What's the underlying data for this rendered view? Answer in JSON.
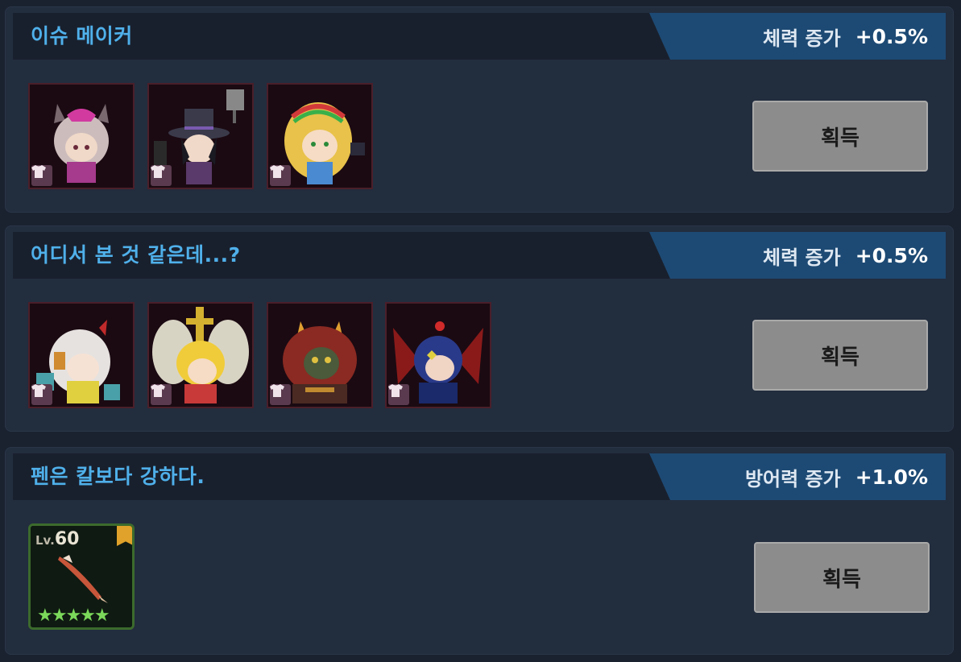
{
  "achievements": [
    {
      "title": "이슈 메이커",
      "bonus_stat": "체력 증가",
      "bonus_value": "+0.5%",
      "button_label": "획득",
      "rewards": [
        "costume-character-1",
        "costume-character-2",
        "costume-character-3"
      ]
    },
    {
      "title": "어디서 본 것 같은데...?",
      "bonus_stat": "체력 증가",
      "bonus_value": "+0.5%",
      "button_label": "획득",
      "rewards": [
        "costume-character-1",
        "costume-character-2",
        "costume-character-3",
        "costume-character-4"
      ]
    },
    {
      "title": "펜은 칼보다 강하다.",
      "bonus_stat": "방어력 증가",
      "bonus_value": "+1.0%",
      "button_label": "획득",
      "weapon": {
        "level_label": "Lv.",
        "level": "60",
        "stars": "★★★★★",
        "star_count": 5
      }
    }
  ],
  "colors": {
    "title": "#4fb0ea",
    "bonus_banner": "#1d4a74",
    "button": "#8c8c8c",
    "panel": "#222d3e"
  },
  "icons": {
    "costume_badge": "shirt-icon",
    "weapon_badge": "bookmark-icon"
  }
}
